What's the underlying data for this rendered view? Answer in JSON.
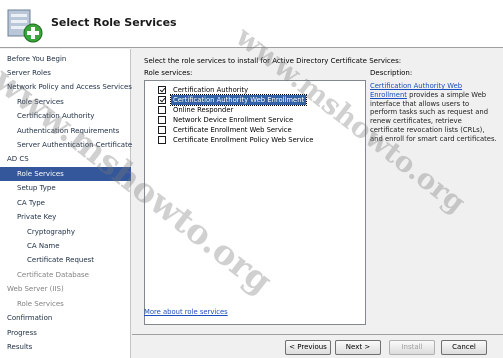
{
  "header": {
    "title": "Select Role Services",
    "icon": "role-services-plus-icon"
  },
  "sidebar": {
    "items": [
      {
        "label": "Before You Begin",
        "state": "normal"
      },
      {
        "label": "Server Roles",
        "state": "normal"
      },
      {
        "label": "Network Policy and Access Services",
        "state": "normal"
      },
      {
        "label": "Role Services",
        "state": "normal"
      },
      {
        "label": "Certification Authority",
        "state": "normal"
      },
      {
        "label": "Authentication Requirements",
        "state": "normal"
      },
      {
        "label": "Server Authentication Certificate",
        "state": "normal"
      },
      {
        "label": "AD CS",
        "state": "normal"
      },
      {
        "label": "Role Services",
        "state": "selected"
      },
      {
        "label": "Setup Type",
        "state": "normal"
      },
      {
        "label": "CA Type",
        "state": "normal"
      },
      {
        "label": "Private Key",
        "state": "normal"
      },
      {
        "label": "Cryptography",
        "state": "normal"
      },
      {
        "label": "CA Name",
        "state": "normal"
      },
      {
        "label": "Certificate Request",
        "state": "normal"
      },
      {
        "label": "Certificate Database",
        "state": "disabled"
      },
      {
        "label": "Web Server (IIS)",
        "state": "disabled"
      },
      {
        "label": "Role Services",
        "state": "disabled"
      },
      {
        "label": "Confirmation",
        "state": "normal"
      },
      {
        "label": "Progress",
        "state": "normal"
      },
      {
        "label": "Results",
        "state": "normal"
      }
    ]
  },
  "main": {
    "intro": "Select the role services to install for Active Directory Certificate Services:",
    "role_services_label": "Role services:",
    "description_label": "Description:",
    "services": [
      {
        "label": "Certification Authority",
        "checked": true,
        "selected": false
      },
      {
        "label": "Certification Authority Web Enrollment",
        "checked": true,
        "selected": true
      },
      {
        "label": "Online Responder",
        "checked": false,
        "selected": false
      },
      {
        "label": "Network Device Enrollment Service",
        "checked": false,
        "selected": false
      },
      {
        "label": "Certificate Enrollment Web Service",
        "checked": false,
        "selected": false
      },
      {
        "label": "Certificate Enrollment Policy Web Service",
        "checked": false,
        "selected": false
      }
    ],
    "description_link": "Certification Authority Web Enrollment",
    "description_text": "provides a simple Web interface that allows users to perform tasks such as request and renew certificates, retrieve certificate revocation lists (CRLs), and enroll for smart card certificates.",
    "more_link": "More about role services"
  },
  "buttons": {
    "previous": "< Previous",
    "next": "Next >",
    "install": "Install",
    "cancel": "Cancel"
  },
  "watermark": "www.mshowto.org"
}
